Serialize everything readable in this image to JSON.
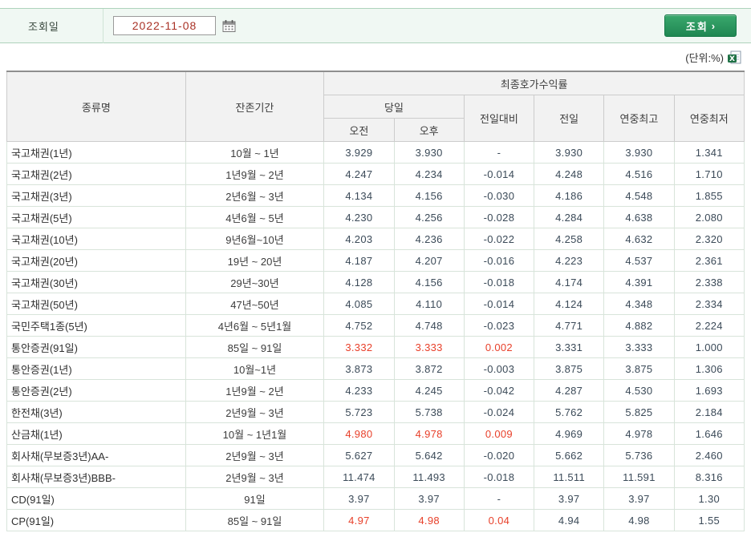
{
  "toolbar": {
    "date_label": "조회일",
    "date_value": "2022-11-08",
    "search_button": "조회"
  },
  "icons": {
    "search_arrow": "›",
    "calendar": "calendar-icon",
    "excel": "excel-export-icon"
  },
  "unit_label": "(단위:%)",
  "colors": {
    "up_red": "#e8402a",
    "number_navy": "#3b4a58",
    "toolbar_bg": "#f0f8f3",
    "toolbar_border": "#aed3bc",
    "button_green": "#2f9a5f",
    "date_red": "#a93226"
  },
  "table": {
    "headers": {
      "type": "종류명",
      "period": "잔존기간",
      "yield_group": "최종호가수익률",
      "today": "당일",
      "am": "오전",
      "pm": "오후",
      "change": "전일대비",
      "prev": "전일",
      "year_high": "연중최고",
      "year_low": "연중최저"
    },
    "rows": [
      {
        "name": "국고채권(1년)",
        "period": "10월 ~ 1년",
        "am": "3.929",
        "pm": "3.930",
        "change": "-",
        "prev": "3.930",
        "high": "3.930",
        "low": "1.341",
        "up": false
      },
      {
        "name": "국고채권(2년)",
        "period": "1년9월 ~ 2년",
        "am": "4.247",
        "pm": "4.234",
        "change": "-0.014",
        "prev": "4.248",
        "high": "4.516",
        "low": "1.710",
        "up": false
      },
      {
        "name": "국고채권(3년)",
        "period": "2년6월 ~ 3년",
        "am": "4.134",
        "pm": "4.156",
        "change": "-0.030",
        "prev": "4.186",
        "high": "4.548",
        "low": "1.855",
        "up": false
      },
      {
        "name": "국고채권(5년)",
        "period": "4년6월 ~ 5년",
        "am": "4.230",
        "pm": "4.256",
        "change": "-0.028",
        "prev": "4.284",
        "high": "4.638",
        "low": "2.080",
        "up": false
      },
      {
        "name": "국고채권(10년)",
        "period": "9년6월~10년",
        "am": "4.203",
        "pm": "4.236",
        "change": "-0.022",
        "prev": "4.258",
        "high": "4.632",
        "low": "2.320",
        "up": false
      },
      {
        "name": "국고채권(20년)",
        "period": "19년 ~ 20년",
        "am": "4.187",
        "pm": "4.207",
        "change": "-0.016",
        "prev": "4.223",
        "high": "4.537",
        "low": "2.361",
        "up": false
      },
      {
        "name": "국고채권(30년)",
        "period": "29년~30년",
        "am": "4.128",
        "pm": "4.156",
        "change": "-0.018",
        "prev": "4.174",
        "high": "4.391",
        "low": "2.338",
        "up": false
      },
      {
        "name": "국고채권(50년)",
        "period": "47년~50년",
        "am": "4.085",
        "pm": "4.110",
        "change": "-0.014",
        "prev": "4.124",
        "high": "4.348",
        "low": "2.334",
        "up": false
      },
      {
        "name": "국민주택1종(5년)",
        "period": "4년6월 ~ 5년1월",
        "am": "4.752",
        "pm": "4.748",
        "change": "-0.023",
        "prev": "4.771",
        "high": "4.882",
        "low": "2.224",
        "up": false
      },
      {
        "name": "통안증권(91일)",
        "period": "85일 ~ 91일",
        "am": "3.332",
        "pm": "3.333",
        "change": "0.002",
        "prev": "3.331",
        "high": "3.333",
        "low": "1.000",
        "up": true
      },
      {
        "name": "통안증권(1년)",
        "period": "10월~1년",
        "am": "3.873",
        "pm": "3.872",
        "change": "-0.003",
        "prev": "3.875",
        "high": "3.875",
        "low": "1.306",
        "up": false
      },
      {
        "name": "통안증권(2년)",
        "period": "1년9월 ~ 2년",
        "am": "4.233",
        "pm": "4.245",
        "change": "-0.042",
        "prev": "4.287",
        "high": "4.530",
        "low": "1.693",
        "up": false
      },
      {
        "name": "한전채(3년)",
        "period": "2년9월 ~ 3년",
        "am": "5.723",
        "pm": "5.738",
        "change": "-0.024",
        "prev": "5.762",
        "high": "5.825",
        "low": "2.184",
        "up": false
      },
      {
        "name": "산금채(1년)",
        "period": "10월 ~ 1년1월",
        "am": "4.980",
        "pm": "4.978",
        "change": "0.009",
        "prev": "4.969",
        "high": "4.978",
        "low": "1.646",
        "up": true
      },
      {
        "name": "회사채(무보증3년)AA-",
        "period": "2년9월 ~ 3년",
        "am": "5.627",
        "pm": "5.642",
        "change": "-0.020",
        "prev": "5.662",
        "high": "5.736",
        "low": "2.460",
        "up": false
      },
      {
        "name": "회사채(무보증3년)BBB-",
        "period": "2년9월 ~ 3년",
        "am": "11.474",
        "pm": "11.493",
        "change": "-0.018",
        "prev": "11.511",
        "high": "11.591",
        "low": "8.316",
        "up": false
      },
      {
        "name": "CD(91일)",
        "period": "91일",
        "am": "3.97",
        "pm": "3.97",
        "change": "-",
        "prev": "3.97",
        "high": "3.97",
        "low": "1.30",
        "up": false
      },
      {
        "name": "CP(91일)",
        "period": "85일 ~ 91일",
        "am": "4.97",
        "pm": "4.98",
        "change": "0.04",
        "prev": "4.94",
        "high": "4.98",
        "low": "1.55",
        "up": true
      }
    ]
  }
}
